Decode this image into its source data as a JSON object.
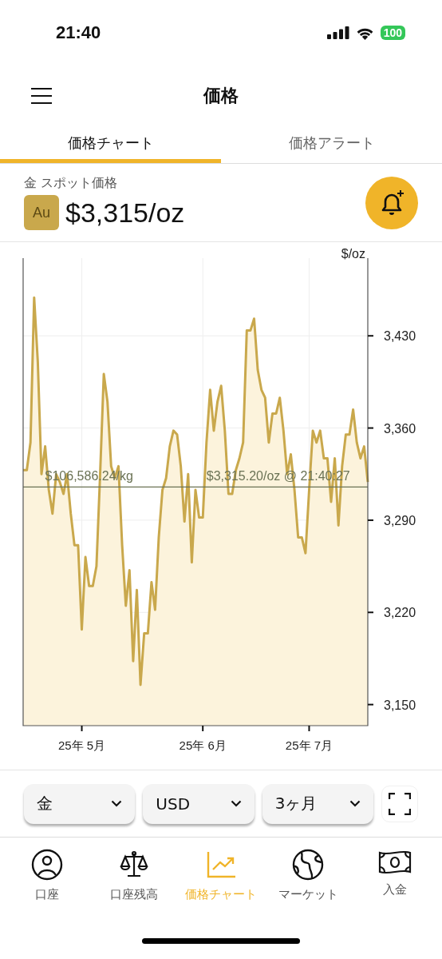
{
  "status_bar": {
    "time": "21:40",
    "battery": "100"
  },
  "header": {
    "title": "価格"
  },
  "tabs": [
    {
      "label": "価格チャート",
      "selected": true
    },
    {
      "label": "価格アラート",
      "selected": false
    }
  ],
  "spot": {
    "label": "金 スポット価格",
    "symbol": "Au",
    "price": "$3,315/oz"
  },
  "chart": {
    "chart_data": {
      "type": "area",
      "ylabel": "$/oz",
      "ylim": [
        3134,
        3489
      ],
      "yticks": [
        {
          "value": 3150,
          "label": "3,150"
        },
        {
          "value": 3220,
          "label": "3,220"
        },
        {
          "value": 3290,
          "label": "3,290"
        },
        {
          "value": 3360,
          "label": "3,360"
        },
        {
          "value": 3430,
          "label": "3,430"
        }
      ],
      "categories": [
        null,
        null,
        null,
        null,
        null,
        null,
        null,
        null,
        null,
        null,
        null,
        null,
        null,
        null,
        null,
        null,
        "25年 5月",
        null,
        null,
        null,
        null,
        null,
        null,
        null,
        null,
        null,
        null,
        null,
        null,
        null,
        null,
        null,
        null,
        null,
        null,
        null,
        null,
        null,
        null,
        null,
        null,
        null,
        null,
        null,
        null,
        null,
        null,
        null,
        null,
        "25年 6月",
        null,
        null,
        null,
        null,
        null,
        null,
        null,
        null,
        null,
        null,
        null,
        null,
        null,
        null,
        null,
        null,
        null,
        null,
        null,
        null,
        null,
        null,
        null,
        null,
        null,
        null,
        null,
        null,
        "25年 7月",
        null,
        null,
        null,
        null,
        null,
        null,
        null,
        null,
        null,
        null,
        null,
        null,
        null,
        null,
        null,
        null
      ],
      "series": [
        {
          "color": "#c9a84c",
          "values": [
            3328,
            3328,
            3349,
            3459,
            3410,
            3325,
            3346,
            3313,
            3295,
            3325,
            3319,
            3310,
            3325,
            3295,
            3271,
            3271,
            3207,
            3262,
            3240,
            3240,
            3255,
            3325,
            3401,
            3380,
            3331,
            3322,
            3331,
            3271,
            3225,
            3252,
            3183,
            3237,
            3165,
            3204,
            3204,
            3243,
            3222,
            3277,
            3313,
            3322,
            3346,
            3358,
            3355,
            3331,
            3289,
            3325,
            3258,
            3313,
            3292,
            3292,
            3349,
            3389,
            3358,
            3380,
            3392,
            3358,
            3310,
            3310,
            3328,
            3337,
            3349,
            3434,
            3434,
            3443,
            3404,
            3389,
            3383,
            3349,
            3371,
            3371,
            3383,
            3358,
            3325,
            3340,
            3313,
            3277,
            3277,
            3265,
            3313,
            3358,
            3349,
            3358,
            3337,
            3337,
            3304,
            3337,
            3286,
            3331,
            3355,
            3355,
            3374,
            3349,
            3337,
            3346,
            3319
          ]
        }
      ],
      "grid": true,
      "ref_lines": [
        {
          "axis": "y",
          "value": 3315.2
        }
      ],
      "annotations": [
        "$106,586.24/kg",
        "$3,315.20/oz @ 21:40:27"
      ]
    }
  },
  "selectors": [
    {
      "value": "金"
    },
    {
      "value": "USD"
    },
    {
      "value": "3ヶ月"
    }
  ],
  "nav": [
    {
      "kind": "account",
      "label": "口座",
      "selected": false
    },
    {
      "kind": "balance",
      "label": "口座残高",
      "selected": false
    },
    {
      "kind": "chart",
      "label": "価格チャート",
      "selected": true
    },
    {
      "kind": "market",
      "label": "マーケット",
      "selected": false
    },
    {
      "kind": "deposit",
      "label": "入金",
      "selected": false
    }
  ]
}
